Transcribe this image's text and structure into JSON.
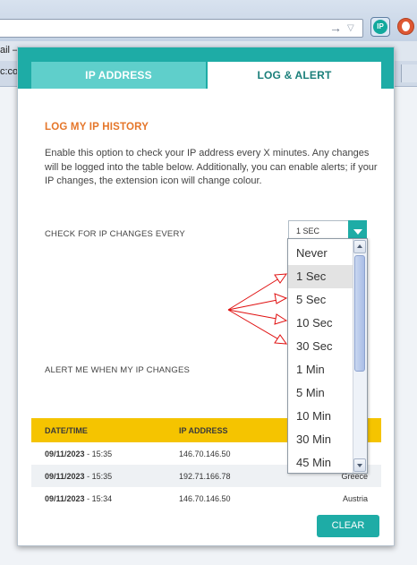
{
  "browser": {
    "bookmark_text": "ail –",
    "tab_text": "c:co",
    "ext_icon_label": "IP"
  },
  "tabs": [
    {
      "label": "IP ADDRESS",
      "active": false
    },
    {
      "label": "LOG & ALERT",
      "active": true
    }
  ],
  "log": {
    "title": "LOG MY IP HISTORY",
    "description": "Enable this option to check your IP address every X minutes. Any changes will be logged into the table below. Additionally, you can enable alerts; if your IP changes, the extension icon will change colour.",
    "check_label": "CHECK FOR IP CHANGES EVERY",
    "alert_label": "ALERT ME WHEN MY IP CHANGES",
    "interval_selected": "1 SEC",
    "interval_options": [
      "Never",
      "1 Sec",
      "5 Sec",
      "10 Sec",
      "30 Sec",
      "1 Min",
      "5 Min",
      "10 Min",
      "30 Min",
      "45 Min"
    ],
    "highlighted_option": "1 Sec"
  },
  "table": {
    "headers": [
      "DATE/TIME",
      "IP ADDRESS"
    ],
    "rows": [
      {
        "date": "09/11/2023",
        "time": "15:35",
        "ip": "146.70.146.50",
        "country": ""
      },
      {
        "date": "09/11/2023",
        "time": "15:35",
        "ip": "192.71.166.78",
        "country": "Greece"
      },
      {
        "date": "09/11/2023",
        "time": "15:34",
        "ip": "146.70.146.50",
        "country": "Austria"
      }
    ]
  },
  "clear_label": "CLEAR",
  "colors": {
    "teal": "#1eaca6",
    "tab_inactive": "#5fcfcb",
    "orange_title": "#e5762a",
    "table_header": "#f5c400",
    "annotation_red": "#e01010"
  }
}
